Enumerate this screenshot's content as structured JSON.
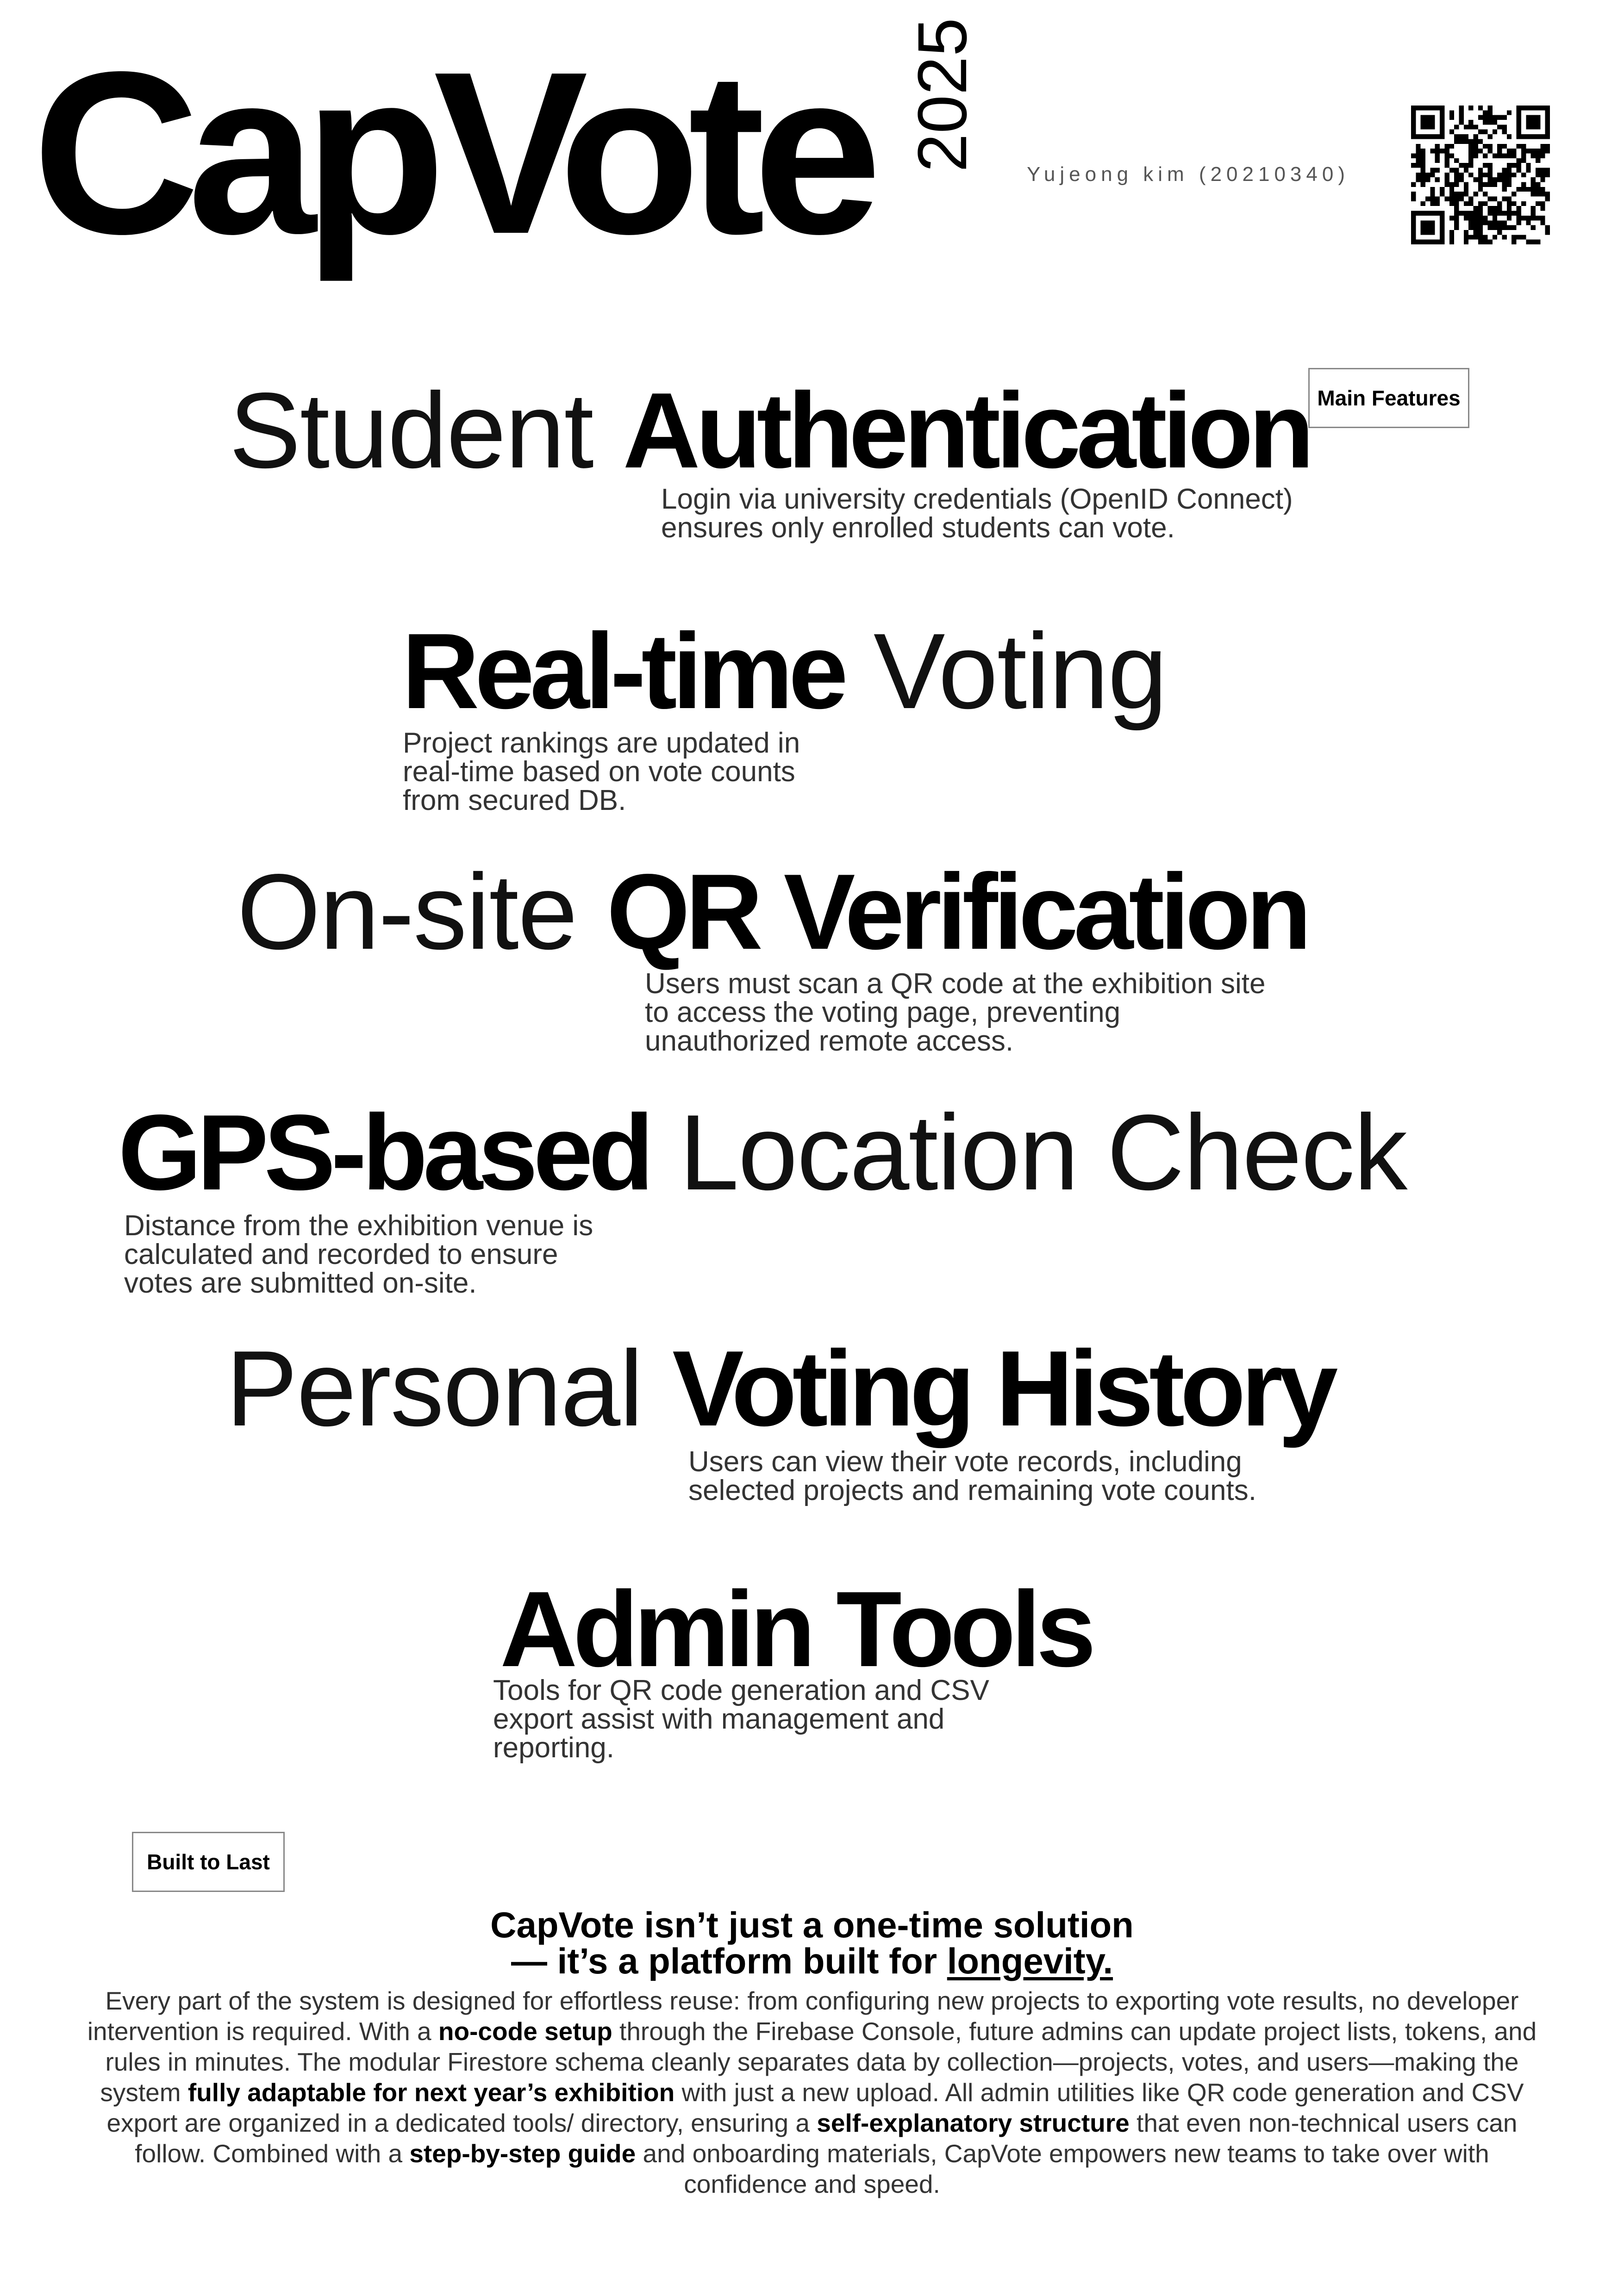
{
  "header": {
    "title": "CapVote",
    "year": "2025",
    "author": "Yujeong kim (20210340)",
    "qr_icon": "qr-code-icon"
  },
  "tags": {
    "main_features": "Main Features",
    "built_to_last": "Built to Last"
  },
  "features": [
    {
      "light": "Student",
      "bold": "Authentication",
      "desc_lines": [
        "Login via university credentials (OpenID Connect)",
        "ensures only enrolled students can vote."
      ]
    },
    {
      "bold": "Real-time",
      "light": "Voting",
      "desc_lines": [
        "Project rankings are updated in",
        "real-time based on vote counts",
        "from secured DB."
      ]
    },
    {
      "light": "On-site",
      "bold": "QR Verification",
      "desc_lines": [
        "Users must scan a QR code at the exhibition site",
        "to access the voting page, preventing",
        "unauthorized remote access."
      ]
    },
    {
      "bold": "GPS-based",
      "light": "Location Check",
      "desc_lines": [
        "Distance from the exhibition venue is",
        "calculated and recorded to ensure",
        "votes are submitted on-site."
      ]
    },
    {
      "light": "Personal",
      "bold": "Voting History",
      "desc_lines": [
        "Users can view their vote records, including",
        "selected projects and remaining vote counts."
      ]
    },
    {
      "bold": "Admin Tools",
      "desc_lines": [
        "Tools for QR code generation and CSV",
        "export assist with management and",
        "reporting."
      ]
    }
  ],
  "closing": {
    "headline_line1": "CapVote isn’t just a one-time solution",
    "headline_line2_prefix": "— it’s a platform built for ",
    "headline_line2_emph": "longevity.",
    "body": [
      {
        "t": "Every part of the system is designed for effortless reuse: from configuring new projects to exporting vote results, no developer intervention is required. With a "
      },
      {
        "b": "no-code setup"
      },
      {
        "t": " through the Firebase Console, future admins can update project lists, tokens, and rules in minutes. The modular Firestore schema cleanly separates data by collection—projects, votes, and users—making the system "
      },
      {
        "b": "fully adaptable for next year’s exhibition"
      },
      {
        "t": " with just a new upload. All admin utilities like QR code generation and CSV export are organized in a dedicated tools/ directory, ensuring a "
      },
      {
        "b": "self-explanatory structure"
      },
      {
        "t": " that even non-technical users can follow. Combined with a "
      },
      {
        "b": "step-by-step guide"
      },
      {
        "t": " and onboarding materials, CapVote empowers new teams to take over with confidence and speed."
      }
    ]
  }
}
